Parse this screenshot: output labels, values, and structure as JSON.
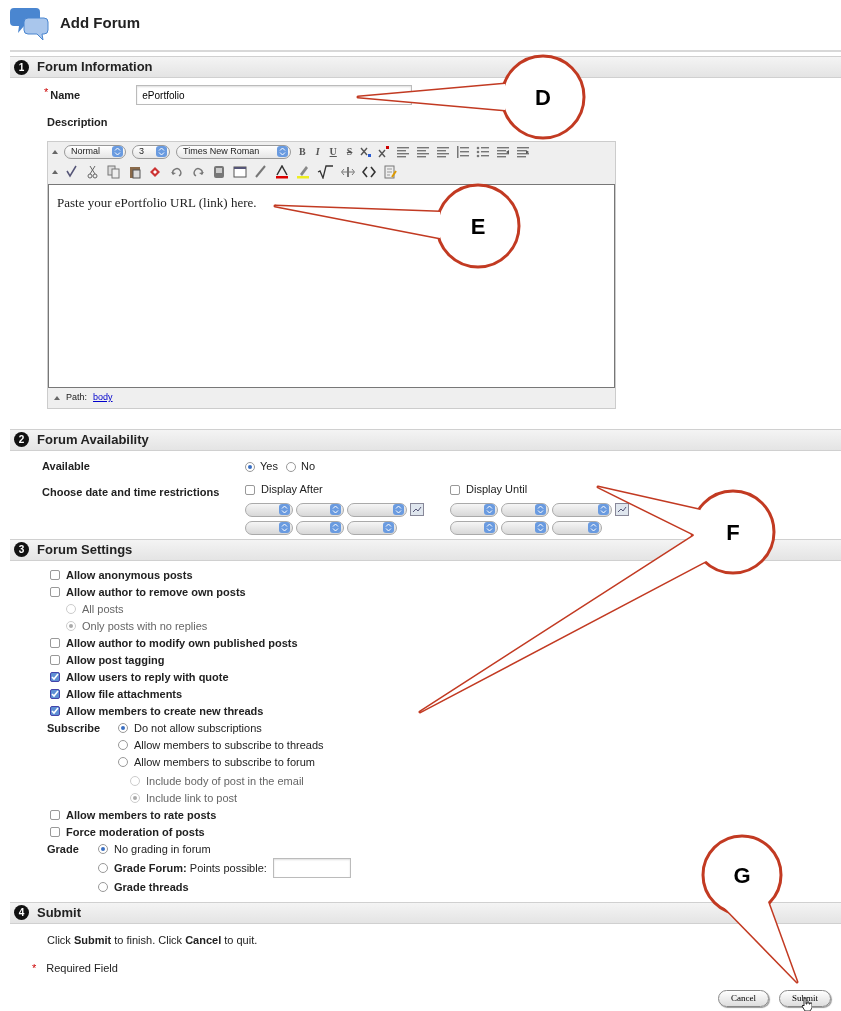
{
  "page": {
    "title": "Add Forum"
  },
  "forum_information": {
    "number": "1",
    "heading": "Forum Information",
    "name": {
      "required_mark": "*",
      "label": "Name",
      "value": "ePortfolio"
    },
    "description": {
      "label": "Description",
      "editor": {
        "format": "Normal",
        "size": "3",
        "font": "Times New Roman",
        "text_buttons": [
          "B",
          "I",
          "U",
          "S"
        ],
        "content": "Paste your ePortfolio URL (link) here.",
        "path_label": "Path:",
        "path_link": "body"
      }
    }
  },
  "forum_availability": {
    "number": "2",
    "heading": "Forum Availability",
    "available": {
      "label": "Available",
      "options": [
        {
          "label": "Yes",
          "selected": true
        },
        {
          "label": "No",
          "selected": false
        }
      ]
    },
    "date_restrictions": {
      "label": "Choose date and time restrictions",
      "options": [
        {
          "label": "Display After",
          "checked": false
        },
        {
          "label": "Display Until",
          "checked": false
        }
      ]
    }
  },
  "forum_settings": {
    "number": "3",
    "heading": "Forum Settings",
    "options_top": [
      {
        "label": "Allow anonymous posts",
        "checked": false
      },
      {
        "label": "Allow author to remove own posts",
        "checked": false,
        "choices": [
          {
            "label": "All posts",
            "selected": false,
            "disabled": true
          },
          {
            "label": "Only posts with no replies",
            "selected": true,
            "disabled": true
          }
        ]
      },
      {
        "label": "Allow author to modify own published posts",
        "checked": false
      },
      {
        "label": "Allow post tagging",
        "checked": false
      },
      {
        "label": "Allow users to reply with quote",
        "checked": true
      },
      {
        "label": "Allow file attachments",
        "checked": true
      },
      {
        "label": "Allow members to create new threads",
        "checked": true
      }
    ],
    "subscribe": {
      "label": "Subscribe",
      "choices": [
        {
          "label": "Do not allow subscriptions",
          "selected": true,
          "disabled": false
        },
        {
          "label": "Allow members to subscribe to threads",
          "selected": false,
          "disabled": false
        },
        {
          "label": "Allow members to subscribe to forum",
          "selected": false,
          "disabled": false,
          "children": [
            {
              "label": "Include body of post in the email",
              "selected": false,
              "disabled": true
            },
            {
              "label": "Include link to post",
              "selected": true,
              "disabled": true
            }
          ]
        }
      ]
    },
    "options_bottom": [
      {
        "label": "Allow members to rate posts",
        "checked": false
      },
      {
        "label": "Force moderation of posts",
        "checked": false
      }
    ],
    "grade": {
      "label": "Grade",
      "choices": [
        {
          "label": "No grading in forum",
          "selected": true,
          "with_field": false
        },
        {
          "label": "**Grade Forum:** Points possible:",
          "selected": false,
          "with_field": true
        },
        {
          "label": "**Grade threads**",
          "selected": false,
          "with_field": false
        }
      ]
    }
  },
  "submit_section": {
    "number": "4",
    "heading": "Submit",
    "instructions": "Click **Submit** to finish. Click **Cancel** to quit.",
    "required_note": {
      "mark": "*",
      "text": "Required Field"
    },
    "buttons": [
      {
        "label": "Cancel"
      },
      {
        "label": "Submit"
      }
    ]
  },
  "callouts": [
    {
      "letter": "D"
    },
    {
      "letter": "E"
    },
    {
      "letter": "F"
    },
    {
      "letter": "G"
    }
  ]
}
